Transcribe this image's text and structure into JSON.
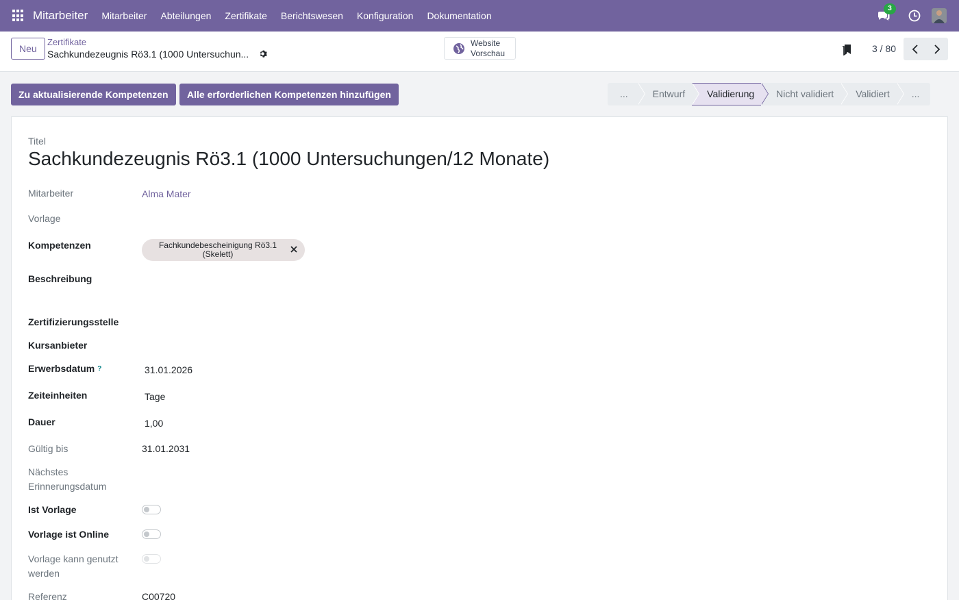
{
  "navbar": {
    "brand": "Mitarbeiter",
    "menu": [
      "Mitarbeiter",
      "Abteilungen",
      "Zertifikate",
      "Berichtswesen",
      "Konfiguration",
      "Dokumentation"
    ],
    "chat_badge": "3"
  },
  "control_panel": {
    "new_label": "Neu",
    "breadcrumb_parent": "Zertifikate",
    "breadcrumb_current": "Sachkundezeugnis Rö3.1 (1000 Untersuchun...",
    "website_line1": "Website",
    "website_line2": "Vorschau",
    "pager": "3 / 80"
  },
  "actions": {
    "update_label": "Zu aktualisierende Kompetenzen",
    "add_label": "Alle erforderlichen Kompetenzen hinzufügen"
  },
  "statusbar": {
    "more_left": "...",
    "stages": [
      "Entwurf",
      "Validierung",
      "Nicht validiert",
      "Validiert"
    ],
    "active": "Validierung",
    "more_right": "..."
  },
  "form": {
    "title_label": "Titel",
    "title_value": "Sachkundezeugnis Rö3.1 (1000 Untersuchungen/12 Monate)",
    "employee_label": "Mitarbeiter",
    "employee_value": "Alma Mater",
    "template_label": "Vorlage",
    "competences_label": "Kompetenzen",
    "competence_tag": "Fachkundebescheinigung Rö3.1 (Skelett)",
    "description_label": "Beschreibung",
    "cert_body_label": "Zertifizierungsstelle",
    "course_provider_label": "Kursanbieter",
    "acquired_label": "Erwerbsdatum",
    "acquired_help": "?",
    "acquired_value": "31.01.2026",
    "time_unit_label": "Zeiteinheiten",
    "time_unit_value": "Tage",
    "duration_label": "Dauer",
    "duration_value": "1,00",
    "valid_until_label": "Gültig bis",
    "valid_until_value": "31.01.2031",
    "next_reminder_label": "Nächstes Erinnerungsdatum",
    "is_template_label": "Ist Vorlage",
    "template_online_label": "Vorlage ist Online",
    "template_usable_label": "Vorlage kann genutzt werden",
    "reference_label": "Referenz",
    "reference_value": "C00720"
  },
  "colors": {
    "brand": "#71639e",
    "badge": "#28a745"
  }
}
